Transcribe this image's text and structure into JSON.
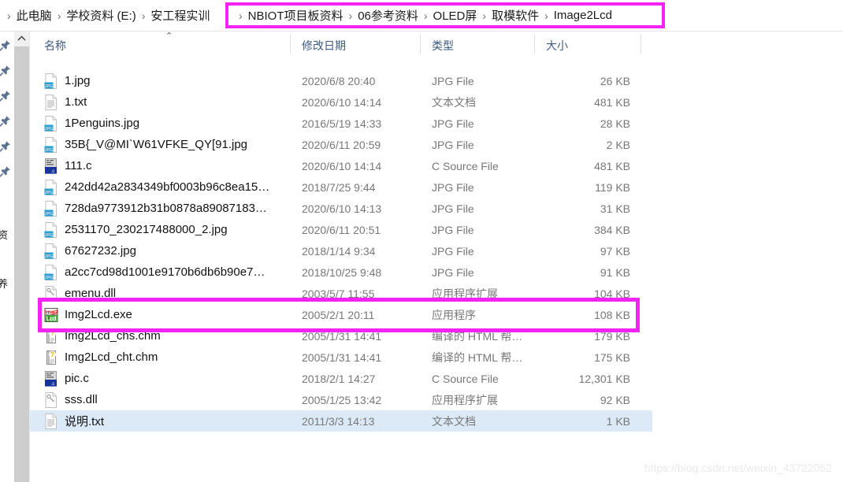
{
  "breadcrumb": {
    "separator": "›",
    "leading_items": [
      {
        "label": "此电脑"
      },
      {
        "label": "学校资料 (E:)"
      },
      {
        "label": "安工程实训"
      }
    ],
    "highlighted_items": [
      {
        "label": "NBIOT项目板资料"
      },
      {
        "label": "06参考资料"
      },
      {
        "label": "OLED屏"
      },
      {
        "label": "取模软件"
      },
      {
        "label": "Image2Lcd"
      }
    ],
    "highlight_color": "#f522f5"
  },
  "left_rail": {
    "pin_icon_name": "pin-icon",
    "pin_count": 6,
    "clipped_labels": [
      "资",
      "养"
    ]
  },
  "scrollbar": {
    "up_arrow": "⌃",
    "thumb_color": "#cdcdcd",
    "track_color": "#f0f0f0"
  },
  "columns": {
    "name": "名称",
    "date_modified": "修改日期",
    "type": "类型",
    "size": "大小",
    "sort_caret": "⌃"
  },
  "files": [
    {
      "name": "1.jpg",
      "date": "2020/6/8 20:40",
      "type": "JPG File",
      "size": "26 KB",
      "icon": "jpg-file-icon",
      "selected": false
    },
    {
      "name": "1.txt",
      "date": "2020/6/10 14:14",
      "type": "文本文档",
      "size": "481 KB",
      "icon": "text-file-icon",
      "selected": false
    },
    {
      "name": "1Penguins.jpg",
      "date": "2016/5/19 14:33",
      "type": "JPG File",
      "size": "28 KB",
      "icon": "jpg-file-icon",
      "selected": false
    },
    {
      "name": "35B{_V@MI`W61VFKE_QY[91.jpg",
      "date": "2020/6/11 20:59",
      "type": "JPG File",
      "size": "2 KB",
      "icon": "jpg-file-icon",
      "selected": false
    },
    {
      "name": "111.c",
      "date": "2020/6/10 14:14",
      "type": "C Source File",
      "size": "481 KB",
      "icon": "c-source-file-icon",
      "selected": false
    },
    {
      "name": "242dd42a2834349bf0003b96c8ea15…",
      "date": "2018/7/25 9:44",
      "type": "JPG File",
      "size": "119 KB",
      "icon": "jpg-file-icon",
      "selected": false
    },
    {
      "name": "728da9773912b31b0878a89087183…",
      "date": "2020/6/10 14:13",
      "type": "JPG File",
      "size": "31 KB",
      "icon": "jpg-file-icon",
      "selected": false
    },
    {
      "name": "2531170_230217488000_2.jpg",
      "date": "2020/6/11 20:51",
      "type": "JPG File",
      "size": "384 KB",
      "icon": "jpg-file-icon",
      "selected": false
    },
    {
      "name": "67627232.jpg",
      "date": "2018/1/14 9:34",
      "type": "JPG File",
      "size": "97 KB",
      "icon": "jpg-file-icon",
      "selected": false
    },
    {
      "name": "a2cc7cd98d1001e9170b6db6b90e7…",
      "date": "2018/10/25 9:48",
      "type": "JPG File",
      "size": "91 KB",
      "icon": "jpg-file-icon",
      "selected": false
    },
    {
      "name": "emenu.dll",
      "date": "2003/5/7 11:55",
      "type": "应用程序扩展",
      "size": "104 KB",
      "icon": "dll-file-icon",
      "selected": false
    },
    {
      "name": "Img2Lcd.exe",
      "date": "2005/2/1 20:11",
      "type": "应用程序",
      "size": "108 KB",
      "icon": "img2lcd-app-icon",
      "selected": false
    },
    {
      "name": "Img2Lcd_chs.chm",
      "date": "2005/1/31 14:41",
      "type": "编译的 HTML 帮…",
      "size": "179 KB",
      "icon": "chm-help-file-icon",
      "selected": false
    },
    {
      "name": "Img2Lcd_cht.chm",
      "date": "2005/1/31 14:41",
      "type": "编译的 HTML 帮…",
      "size": "175 KB",
      "icon": "chm-help-file-icon",
      "selected": false
    },
    {
      "name": "pic.c",
      "date": "2018/2/1 14:27",
      "type": "C Source File",
      "size": "12,301 KB",
      "icon": "c-source-file-icon",
      "selected": false
    },
    {
      "name": "sss.dll",
      "date": "2005/1/25 13:42",
      "type": "应用程序扩展",
      "size": "92 KB",
      "icon": "dll-file-icon",
      "selected": false
    },
    {
      "name": "说明.txt",
      "date": "2011/3/3 14:13",
      "type": "文本文档",
      "size": "1 KB",
      "icon": "text-file-icon",
      "selected": true
    }
  ],
  "annotations": {
    "exe_highlight_color": "#f522f5",
    "exe_highlight_target": "Img2Lcd.exe"
  },
  "watermark": {
    "text": "https://blog.csdn.net/weixin_43722052"
  }
}
